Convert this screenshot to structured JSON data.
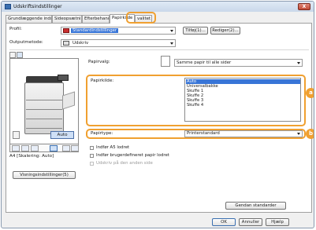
{
  "window": {
    "title": "Udskriftsindstillinger",
    "close_label": "X"
  },
  "tabs": [
    {
      "label": "Grundlæggende indstillinger"
    },
    {
      "label": "Sideopsætning"
    },
    {
      "label": "Efterbehandlin"
    },
    {
      "label": "Papirkilde"
    },
    {
      "label": "valitet"
    }
  ],
  "profile": {
    "label": "Profil:",
    "value": "Standardindstillinger",
    "add_label": "Tilføj(1)...",
    "edit_label": "Rediger(2)..."
  },
  "output": {
    "label": "Outputmetode:",
    "value": "Udskriv"
  },
  "paper_select": {
    "label": "Papirvalg:",
    "value": "Samme papir til alle sider"
  },
  "paper_source": {
    "label": "Papirkilde:",
    "options": [
      "Auto",
      "Universalbakke",
      "Skuffe 1",
      "Skuffe 2",
      "Skuffe 3",
      "Skuffe 4"
    ],
    "selected_index": 0
  },
  "paper_type": {
    "label": "Papirtype:",
    "value": "Printerstandard"
  },
  "badges": {
    "a": "a",
    "b": "b"
  },
  "preview": {
    "auto_label": "Auto",
    "caption": "A4 [Skalering: Auto]"
  },
  "checkboxes": [
    {
      "label": "Indfør A5 lodret",
      "checked": false,
      "enabled": true
    },
    {
      "label": "Indfør brugerdefineret papir lodret",
      "checked": false,
      "enabled": true
    },
    {
      "label": "Udskriv på den anden side",
      "checked": false,
      "enabled": false
    }
  ],
  "buttons": {
    "view_settings": "Visningsindstillinger(5)",
    "restore_defaults": "Gendan standarder",
    "ok": "OK",
    "cancel": "Annuller",
    "help": "Hjælp"
  },
  "colors": {
    "accent_highlight": "#f0a030",
    "selection": "#3875d7"
  }
}
